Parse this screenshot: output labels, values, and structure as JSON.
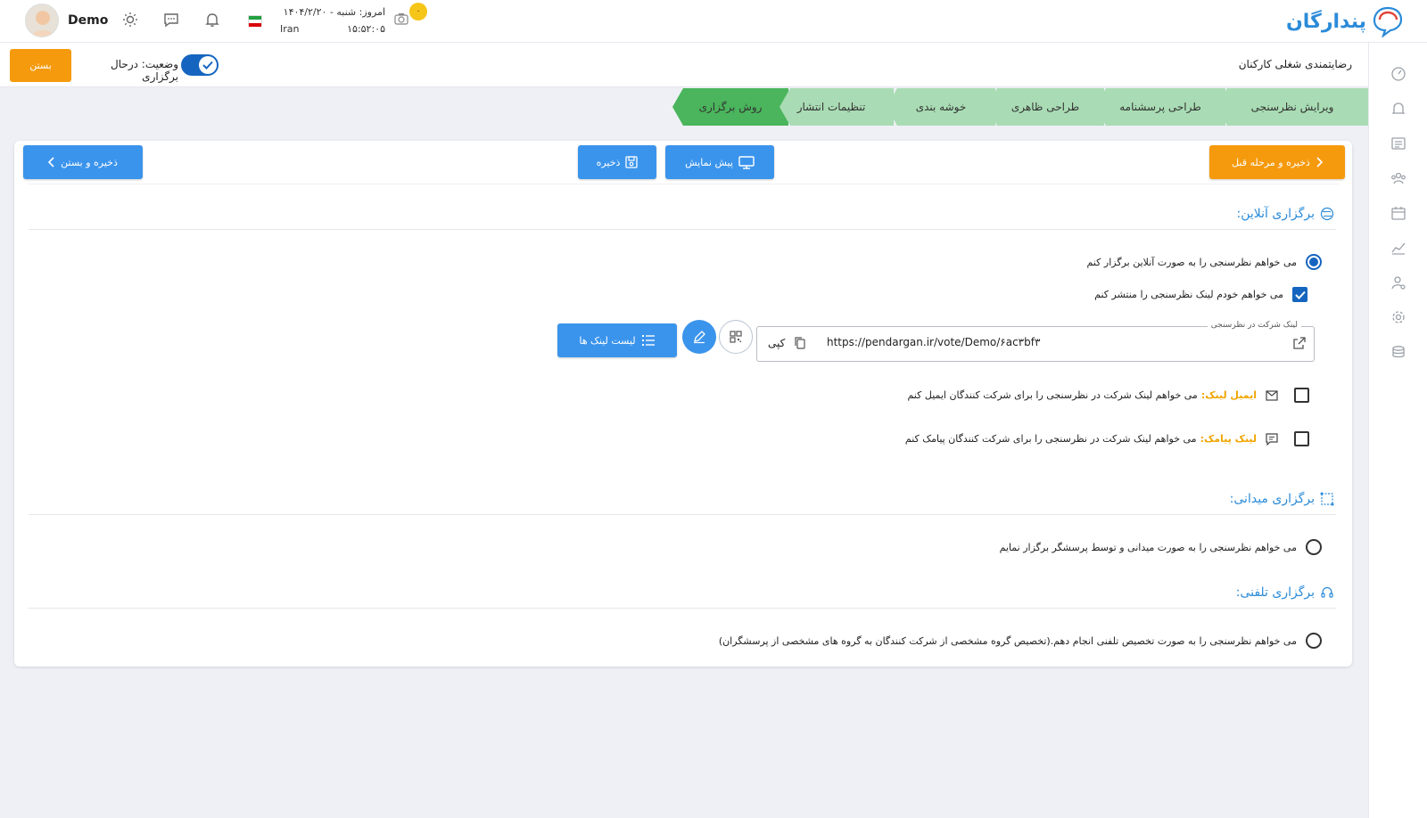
{
  "header": {
    "brand": "پندارگان",
    "user_name": "Demo",
    "date_label": "امروز: شنبه - ۱۴۰۴/۲/۲۰",
    "country": "Iran",
    "time": "۱۵:۵۲:۰۵",
    "notification_count": "۰",
    "icons": [
      "theme-sun-icon",
      "chat-icon",
      "bell-icon",
      "camera-icon"
    ]
  },
  "survey": {
    "title": "رضایتمندی شغلی کارکنان",
    "status_label": "وضعیت: درحال برگزاری",
    "status_on": true,
    "close_label": "بستن"
  },
  "steps": [
    {
      "label": "ویرایش نظرسنجی",
      "active": false
    },
    {
      "label": "طراحی پرسشنامه",
      "active": false
    },
    {
      "label": "طراحی ظاهری",
      "active": false
    },
    {
      "label": "خوشه بندی",
      "active": false
    },
    {
      "label": "تنظیمات انتشار",
      "active": false
    },
    {
      "label": "روش برگزاری",
      "active": true
    }
  ],
  "actions": {
    "save_prev": "ذخیره و مرحله قبل",
    "preview": "پیش نمایش",
    "save": "ذخیره",
    "save_close": "ذخیره و بستن"
  },
  "online": {
    "title": "برگزاری آنلاین:",
    "option_online": "می خواهم نظرسنجی را به صورت آنلاین برگزار کنم",
    "option_publish": "می خواهم خودم لینک نظرسنجی را منتشر کنم",
    "link_label": "لینک شرکت در نظرسنجی",
    "link_url": "https://pendargan.ir/vote/Demo/۶ac۳bf۳",
    "copy_label": "کپی",
    "link_list_label": "لیست لینک ها",
    "email_title": "ایمیل لینک:",
    "email_text": "می خواهم لینک شرکت در نظرسنجی را برای شرکت کنندگان ایمیل کنم",
    "sms_title": "لینک پیامک:",
    "sms_text": "می خواهم لینک شرکت در نظرسنجی را برای شرکت کنندگان پیامک کنم"
  },
  "field": {
    "title": "برگزاری میدانی:",
    "option": "می خواهم نظرسنجی را به صورت میدانی و توسط پرسشگر برگزار نمایم"
  },
  "phone": {
    "title": "برگزاری تلفنی:",
    "option": "می خواهم نظرسنجی را به صورت تخصیص تلفنی انجام دهم.(تخصیص گروه مشخصی از شرکت کنندگان به گروه های مشخصی از پرسشگران)"
  },
  "colors": {
    "primary_blue": "#3b94ec",
    "accent_orange": "#f59a0d",
    "step_green": "#a9dcb4",
    "step_active_green": "#4ab55c",
    "radio_blue": "#1565c0"
  }
}
